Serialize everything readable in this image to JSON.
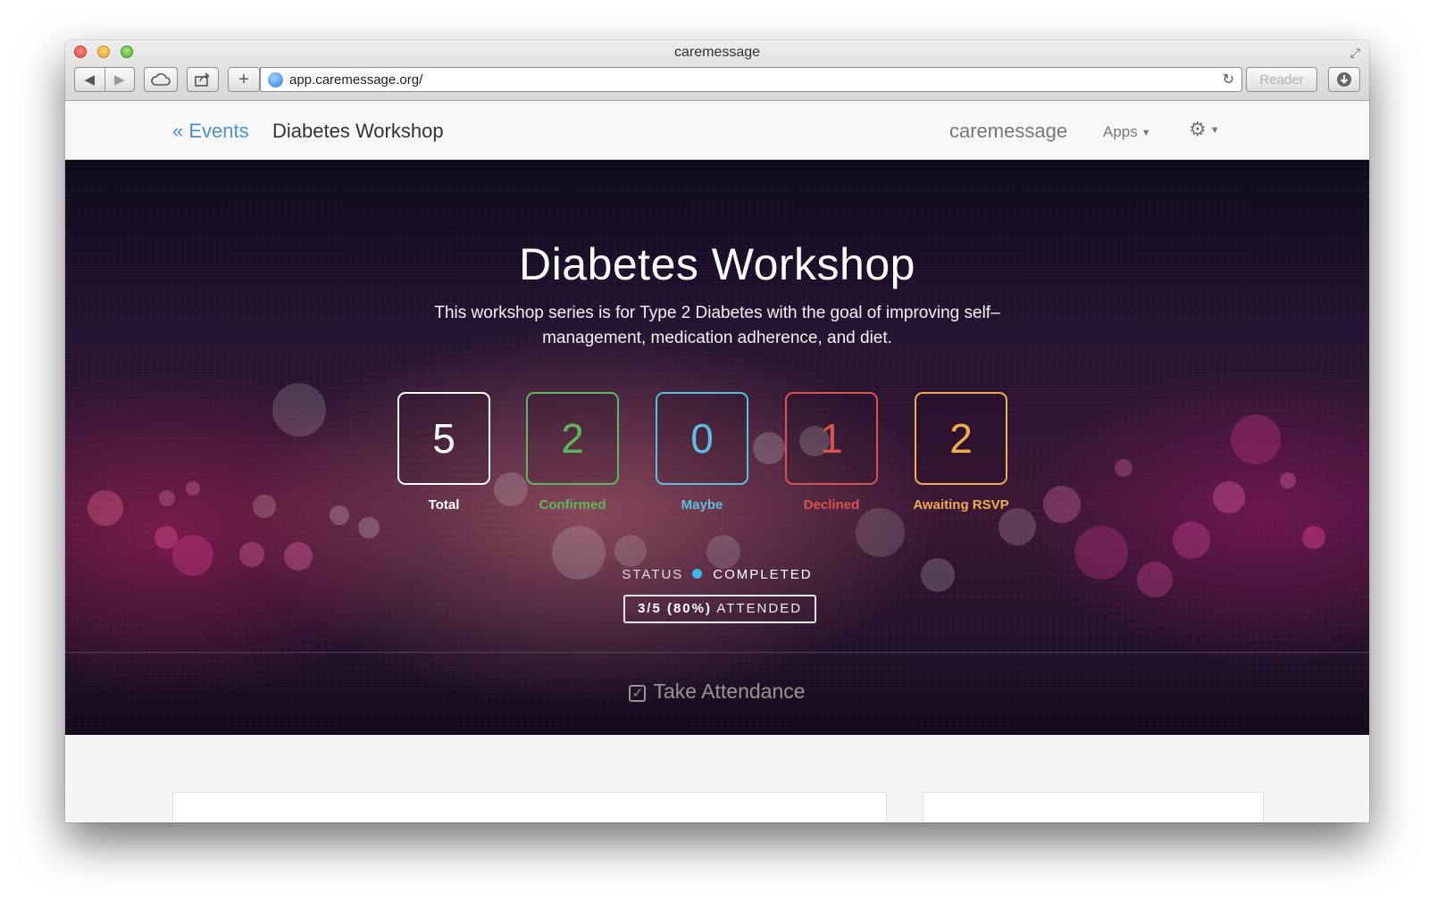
{
  "window": {
    "title": "caremessage",
    "url": "app.caremessage.org/",
    "reader_label": "Reader"
  },
  "navbar": {
    "back_label": "« Events",
    "page_title": "Diabetes Workshop",
    "brand": "caremessage",
    "apps_label": "Apps"
  },
  "hero": {
    "title": "Diabetes Workshop",
    "description": "This workshop series is for Type 2 Diabetes with the goal of improving self–management, medication adherence, and diet.",
    "stats": [
      {
        "value": "5",
        "label": "Total",
        "color": "#ffffff"
      },
      {
        "value": "2",
        "label": "Confirmed",
        "color": "#5cb85c"
      },
      {
        "value": "0",
        "label": "Maybe",
        "color": "#5bc0de"
      },
      {
        "value": "1",
        "label": "Declined",
        "color": "#d9534f"
      },
      {
        "value": "2",
        "label": "Awaiting RSVP",
        "color": "#f0ad4e"
      }
    ],
    "status_label": "STATUS",
    "status_value": "COMPLETED",
    "status_color": "#3fb7e6",
    "attended_count": "3/5 (80%)",
    "attended_label": "ATTENDED",
    "attendance_button": "Take Attendance"
  },
  "icons": {
    "back": "chevron-left-icon",
    "forward": "chevron-right-icon",
    "cloud": "cloud-icon",
    "share": "share-icon",
    "add": "plus-icon",
    "reload": "reload-icon",
    "download": "download-icon",
    "settings": "gear-icon",
    "attendance": "check-square-icon"
  }
}
